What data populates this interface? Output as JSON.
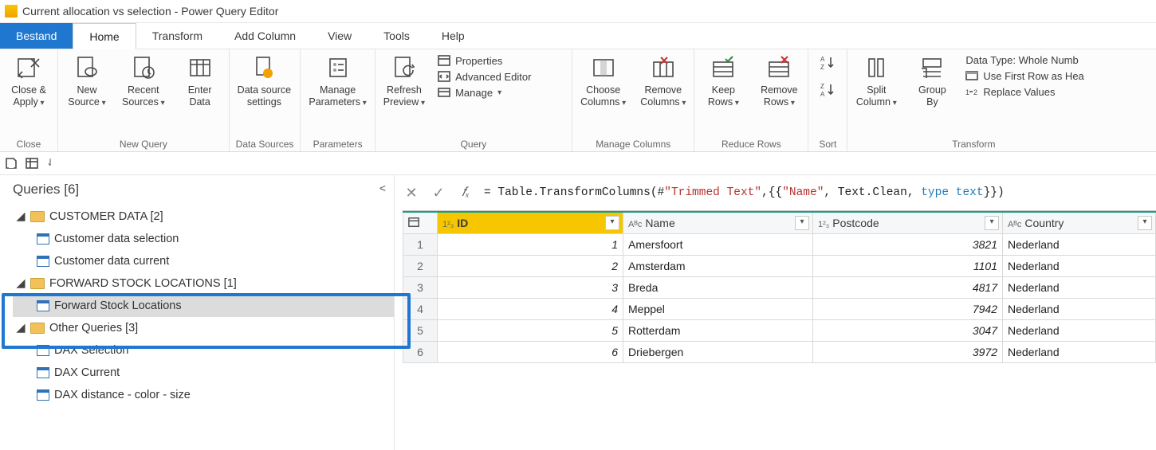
{
  "window_title": "Current allocation vs selection - Power Query Editor",
  "menu": {
    "file": "Bestand",
    "home": "Home",
    "transform": "Transform",
    "addcolumn": "Add Column",
    "view": "View",
    "tools": "Tools",
    "help": "Help"
  },
  "ribbon": {
    "close": {
      "close_apply": "Close &\nApply",
      "group": "Close"
    },
    "newquery": {
      "new_source": "New\nSource",
      "recent_sources": "Recent\nSources",
      "enter_data": "Enter\nData",
      "group": "New Query"
    },
    "datasources": {
      "settings": "Data source\nsettings",
      "group": "Data Sources"
    },
    "parameters": {
      "manage": "Manage\nParameters",
      "group": "Parameters"
    },
    "query": {
      "refresh": "Refresh\nPreview",
      "properties": "Properties",
      "advanced": "Advanced Editor",
      "manage": "Manage",
      "group": "Query"
    },
    "managecols": {
      "choose": "Choose\nColumns",
      "remove": "Remove\nColumns",
      "group": "Manage Columns"
    },
    "reducerows": {
      "keep": "Keep\nRows",
      "remove": "Remove\nRows",
      "group": "Reduce Rows"
    },
    "sort": {
      "group": "Sort"
    },
    "transform": {
      "split": "Split\nColumn",
      "groupby": "Group\nBy",
      "datatype": "Data Type: Whole Numb",
      "firstrow": "Use First Row as Hea",
      "replace": "Replace Values",
      "group": "Transform"
    }
  },
  "queries_pane": {
    "title": "Queries [6]",
    "folders": [
      {
        "name": "CUSTOMER DATA [2]",
        "items": [
          "Customer data selection",
          "Customer data current"
        ]
      },
      {
        "name": "FORWARD STOCK LOCATIONS [1]",
        "items": [
          "Forward Stock Locations"
        ],
        "selected_item": 0
      },
      {
        "name": "Other Queries [3]",
        "items": [
          "DAX Selection",
          "DAX Current",
          "DAX distance - color - size"
        ]
      }
    ]
  },
  "formula": "= Table.TransformColumns(#\"Trimmed Text\",{{\"Name\", Text.Clean, type text}})",
  "formula_parts": {
    "p1": "= Table.TransformColumns(#",
    "s1": "\"Trimmed Text\"",
    "p2": ",{{",
    "s2": "\"Name\"",
    "p3": ", Text.Clean, ",
    "kw": "type text",
    "p4": "}})"
  },
  "columns": [
    {
      "type": "1²₃",
      "name": "ID",
      "selected": true
    },
    {
      "type": "Aᴮc",
      "name": "Name"
    },
    {
      "type": "1²₃",
      "name": "Postcode"
    },
    {
      "type": "Aᴮc",
      "name": "Country"
    }
  ],
  "chart_data": {
    "type": "table",
    "columns": [
      "ID",
      "Name",
      "Postcode",
      "Country"
    ],
    "rows": [
      [
        1,
        "Amersfoort",
        3821,
        "Nederland"
      ],
      [
        2,
        "Amsterdam",
        1101,
        "Nederland"
      ],
      [
        3,
        "Breda",
        4817,
        "Nederland"
      ],
      [
        4,
        "Meppel",
        7942,
        "Nederland"
      ],
      [
        5,
        "Rotterdam",
        3047,
        "Nederland"
      ],
      [
        6,
        "Driebergen",
        3972,
        "Nederland"
      ]
    ]
  }
}
